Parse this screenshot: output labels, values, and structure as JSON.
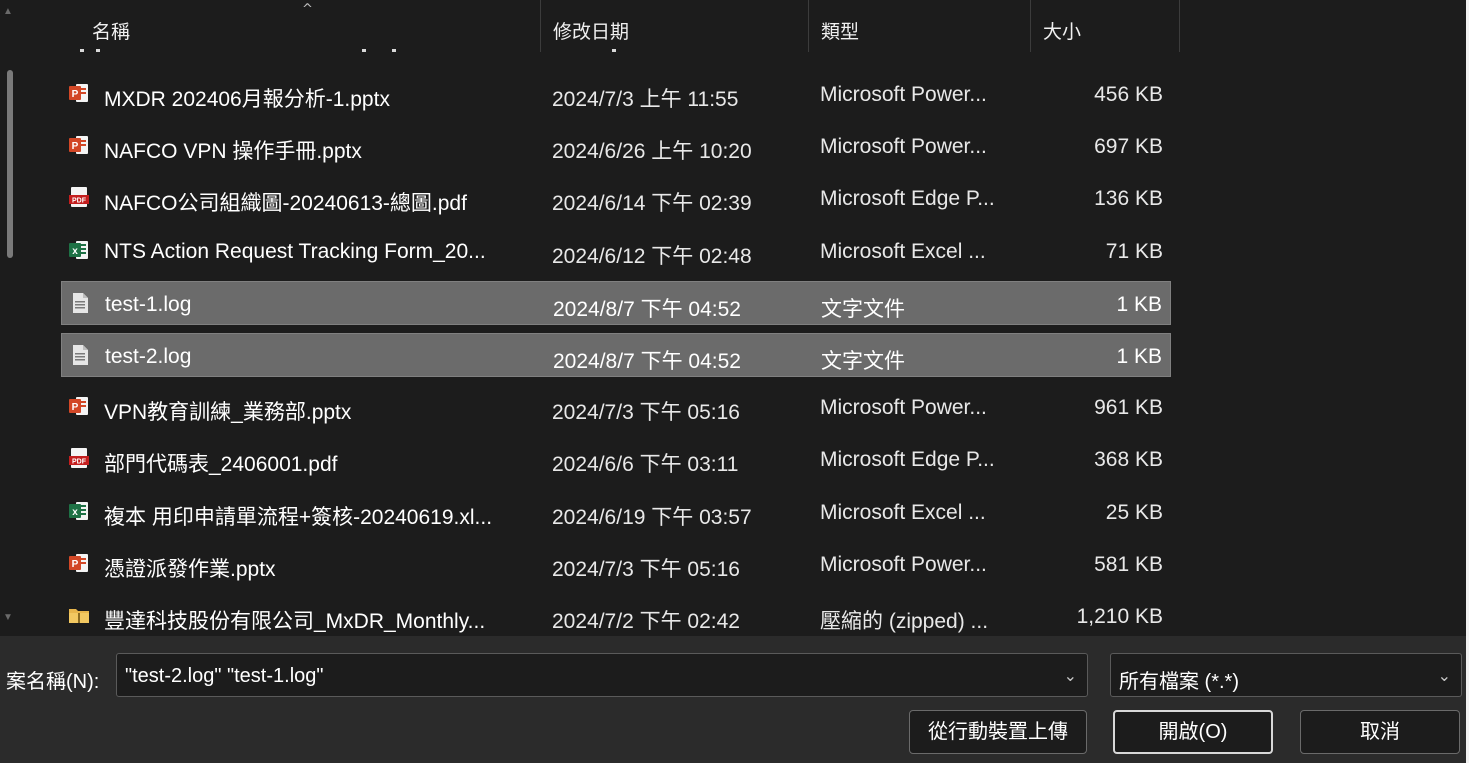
{
  "columns": {
    "name": "名稱",
    "modified": "修改日期",
    "type": "類型",
    "size": "大小"
  },
  "files": [
    {
      "icon": "pptx-icon",
      "name": "MXDR 202406月報分析-1.pptx",
      "modified": "2024/7/3 上午 11:55",
      "type": "Microsoft Power...",
      "size": "456 KB",
      "selected": false
    },
    {
      "icon": "pptx-icon",
      "name": "NAFCO VPN 操作手冊.pptx",
      "modified": "2024/6/26 上午 10:20",
      "type": "Microsoft Power...",
      "size": "697 KB",
      "selected": false
    },
    {
      "icon": "pdf-icon",
      "name": "NAFCO公司組織圖-20240613-總圖.pdf",
      "modified": "2024/6/14 下午 02:39",
      "type": "Microsoft Edge P...",
      "size": "136 KB",
      "selected": false
    },
    {
      "icon": "xlsx-icon",
      "name": "NTS Action Request Tracking Form_20...",
      "modified": "2024/6/12 下午 02:48",
      "type": "Microsoft Excel ...",
      "size": "71 KB",
      "selected": false
    },
    {
      "icon": "text-file-icon",
      "name": "test-1.log",
      "modified": "2024/8/7 下午 04:52",
      "type": "文字文件",
      "size": "1 KB",
      "selected": true
    },
    {
      "icon": "text-file-icon",
      "name": "test-2.log",
      "modified": "2024/8/7 下午 04:52",
      "type": "文字文件",
      "size": "1 KB",
      "selected": true
    },
    {
      "icon": "pptx-icon",
      "name": "VPN教育訓練_業務部.pptx",
      "modified": "2024/7/3 下午 05:16",
      "type": "Microsoft Power...",
      "size": "961 KB",
      "selected": false
    },
    {
      "icon": "pdf-icon",
      "name": "部門代碼表_2406001.pdf",
      "modified": "2024/6/6 下午 03:11",
      "type": "Microsoft Edge P...",
      "size": "368 KB",
      "selected": false
    },
    {
      "icon": "xlsx-icon",
      "name": "複本 用印申請單流程+簽核-20240619.xl...",
      "modified": "2024/6/19 下午 03:57",
      "type": "Microsoft Excel ...",
      "size": "25 KB",
      "selected": false
    },
    {
      "icon": "pptx-icon",
      "name": "憑證派發作業.pptx",
      "modified": "2024/7/3 下午 05:16",
      "type": "Microsoft Power...",
      "size": "581 KB",
      "selected": false
    },
    {
      "icon": "zip-folder-icon",
      "name": "豐達科技股份有限公司_MxDR_Monthly...",
      "modified": "2024/7/2 下午 02:42",
      "type": "壓縮的 (zipped) ...",
      "size": "1,210 KB",
      "selected": false
    }
  ],
  "filename": {
    "label": "案名稱(N):",
    "value": "\"test-2.log\" \"test-1.log\""
  },
  "filetype": {
    "value": "所有檔案 (*.*)"
  },
  "buttons": {
    "upload": "從行動裝置上傳",
    "open": "開啟(O)",
    "cancel": "取消"
  },
  "colors": {
    "background": "#1c1c1c",
    "selected_row": "#6b6b6b",
    "bottom_bar": "#2b2b2b",
    "ppt": "#d24726",
    "pdf": "#c41e1e",
    "excel": "#1e7145",
    "zip": "#e8b64c"
  }
}
